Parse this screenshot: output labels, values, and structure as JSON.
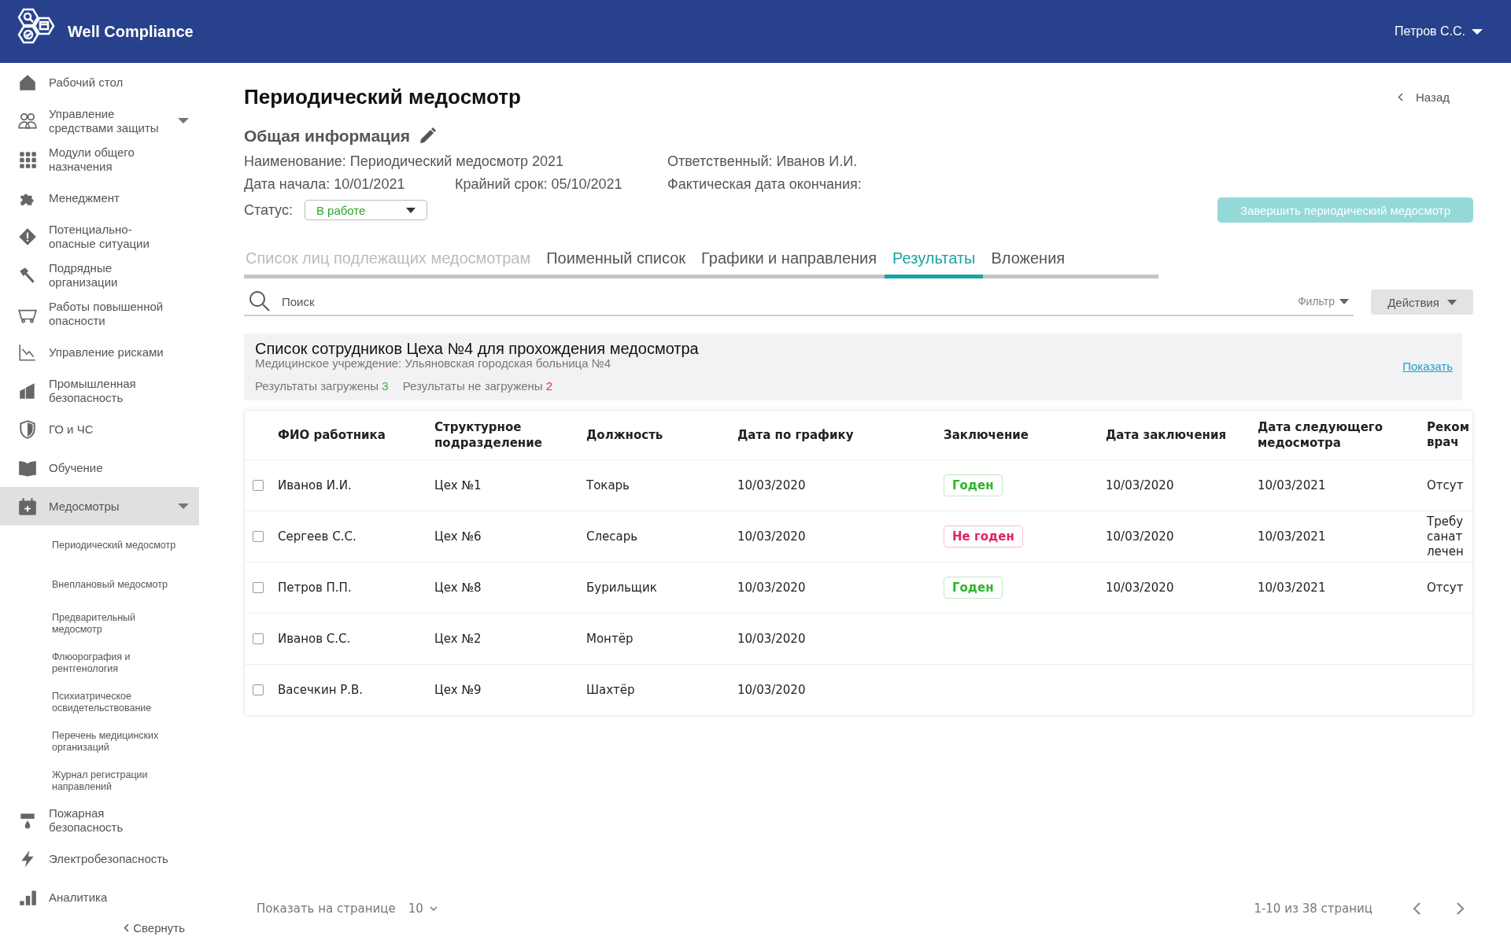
{
  "header": {
    "brand": "Well Compliance",
    "user": "Петров С.С."
  },
  "sidebar": {
    "items": [
      {
        "label": "Рабочий стол",
        "selected": false,
        "kind": "link"
      },
      {
        "label": "Управление средствами защиты",
        "selected": false,
        "kind": "group"
      },
      {
        "label": "Модули общего назначения",
        "selected": false,
        "kind": "link"
      },
      {
        "label": "Менеджмент",
        "selected": false,
        "kind": "link"
      },
      {
        "label": "Потенциально-опасные ситуации",
        "selected": false,
        "kind": "link"
      },
      {
        "label": "Подрядные организации",
        "selected": false,
        "kind": "link"
      },
      {
        "label": "Работы повышенной опасности",
        "selected": false,
        "kind": "link"
      },
      {
        "label": "Управление рисками",
        "selected": false,
        "kind": "link"
      },
      {
        "label": "Промышленная безопасность",
        "selected": false,
        "kind": "link"
      },
      {
        "label": "ГО и ЧС",
        "selected": false,
        "kind": "link"
      },
      {
        "label": "Обучение",
        "selected": false,
        "kind": "link"
      },
      {
        "label": "Медосмотры",
        "selected": true,
        "kind": "group",
        "children": [
          {
            "label": "Периодический медосмотр",
            "selected": false
          },
          {
            "label": "Внеплановый медосмотр",
            "selected": false
          },
          {
            "label": "Предварительный медосмотр",
            "selected": false
          },
          {
            "label": "Флюорография и рентгенология",
            "selected": false
          },
          {
            "label": "Психиатрическое освидетельствование",
            "selected": false
          },
          {
            "label": "Перечень медицинских организаций",
            "selected": false
          },
          {
            "label": "Журнал регистрации направлений",
            "selected": false
          }
        ]
      },
      {
        "label": "Пожарная безопасность",
        "selected": false,
        "kind": "link"
      },
      {
        "label": "Электробезопасность",
        "selected": false,
        "kind": "link"
      },
      {
        "label": "Аналитика",
        "selected": false,
        "kind": "link"
      }
    ],
    "collapse": "Свернуть"
  },
  "page": {
    "title": "Периодический медосмотр",
    "back": "Назад",
    "section": "Общая информация",
    "info": [
      "Наименование: Периодический медосмотр 2021",
      "Ответственный: Иванов И.И.",
      "Дата начала: 10/01/2021",
      "Крайний срок: 05/10/2021",
      "Фактическая дата окончания:"
    ],
    "status_label": "Статус:",
    "status_value": "В работе",
    "finish_button": {
      "label": "Завершить периодический медосмотр",
      "disabled": true
    }
  },
  "tabs": [
    {
      "label": "Список лиц подлежащих медосмотрам",
      "selected": false,
      "disabled": true
    },
    {
      "label": "Поименный список",
      "selected": false,
      "disabled": false
    },
    {
      "label": "Графики и направления",
      "selected": false,
      "disabled": false
    },
    {
      "label": "Результаты",
      "selected": true,
      "disabled": false
    },
    {
      "label": "Вложения",
      "selected": false,
      "disabled": false
    }
  ],
  "toolbar": {
    "search_placeholder": "Поиск",
    "filter": "Фильтр",
    "actions": "Действия"
  },
  "summary": {
    "title": "Список сотрудников Цеха №4 для прохождения медосмотра",
    "subtitle": "Медицинское учреждение: Ульяновская городская больница №4",
    "link": "Показать",
    "counts": [
      {
        "label": "Результаты загружены",
        "count": "3",
        "color": "#2bb52b"
      },
      {
        "label": "Результаты не загружены",
        "count": "2",
        "color": "#e0245e"
      }
    ]
  },
  "table": {
    "columns": [
      "ФИО работника",
      "Структурное подразделение",
      "Должность",
      "Дата по графику",
      "Заключение",
      "Дата заключения",
      "Дата следующего медосмотра",
      "Реком врач"
    ],
    "rows": [
      {
        "checked": false,
        "cells": [
          "Иванов И.И.",
          "Цех №1",
          "Токарь",
          "10/03/2020"
        ],
        "conclusion": {
          "text": "Годен",
          "kind": "fit"
        },
        "rest": [
          "10/03/2020",
          "10/03/2021",
          "Отсут"
        ]
      },
      {
        "checked": false,
        "cells": [
          "Сергеев С.С.",
          "Цех №6",
          "Слесарь",
          "10/03/2020"
        ],
        "conclusion": {
          "text": "Не годен",
          "kind": "unfit"
        },
        "rest": [
          "10/03/2020",
          "10/03/2021",
          "Требу санат лечен"
        ]
      },
      {
        "checked": false,
        "cells": [
          "Петров П.П.",
          "Цех №8",
          "Бурильщик",
          "10/03/2020"
        ],
        "conclusion": {
          "text": "Годен",
          "kind": "fit"
        },
        "rest": [
          "10/03/2020",
          "10/03/2021",
          "Отсут"
        ]
      },
      {
        "checked": false,
        "cells": [
          "Иванов С.С.",
          "Цех №2",
          "Монтёр",
          "10/03/2020"
        ]
      },
      {
        "checked": false,
        "cells": [
          "Васечкин Р.В.",
          "Цех №9",
          "Шахтёр",
          "10/03/2020"
        ]
      }
    ]
  },
  "pagination": {
    "per_page_label": "Показать на странице",
    "per_page": "10",
    "range": "1-10 из 38 страниц"
  }
}
